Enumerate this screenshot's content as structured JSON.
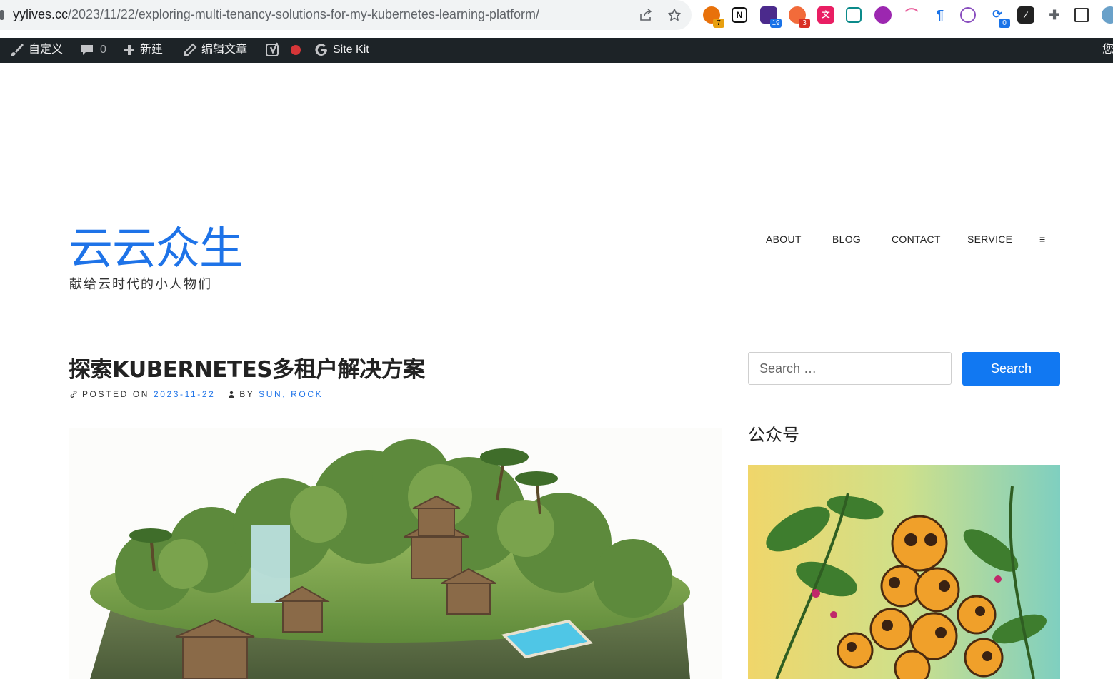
{
  "browser": {
    "url_host": "yylives.cc",
    "url_path": "/2023/11/22/exploring-multi-tenancy-solutions-for-my-kubernetes-learning-platform/",
    "share_icon": "share-icon",
    "bookmark_icon": "star-icon",
    "extensions": [
      {
        "name": "ext-1",
        "badge": "7",
        "color": "#e8710a"
      },
      {
        "name": "notion-ext",
        "badge": "",
        "color": "#111111"
      },
      {
        "name": "ext-graduation",
        "badge": "19",
        "color": "#4b2a8c"
      },
      {
        "name": "ext-orange",
        "badge": "3",
        "color": "#f26b3a"
      },
      {
        "name": "ext-translate",
        "badge": "",
        "color": "#e91e63"
      },
      {
        "name": "ext-teal",
        "badge": "",
        "color": "#0b8a8a"
      },
      {
        "name": "ext-purple",
        "badge": "",
        "color": "#9c27b0"
      },
      {
        "name": "ext-pink",
        "badge": "",
        "color": "#e85d9b"
      },
      {
        "name": "ext-blue",
        "badge": "",
        "color": "#1a73e8"
      },
      {
        "name": "openai-ext",
        "badge": "",
        "color": "#8a4fbf"
      },
      {
        "name": "ext-sync",
        "badge": "0",
        "color": "#1a73e8"
      },
      {
        "name": "ext-dark",
        "badge": "",
        "color": "#222222"
      }
    ],
    "puzzle_icon": "puzzle-icon",
    "sidepanel_icon": "side-panel-icon"
  },
  "adminbar": {
    "customize": "自定义",
    "comments_count": "0",
    "new": "新建",
    "edit_post": "编辑文章",
    "site_kit": "Site Kit",
    "greeting_partial": "您"
  },
  "site": {
    "title": "云云众生",
    "tagline": "献给云时代的小人物们"
  },
  "nav": {
    "items": [
      "ABOUT",
      "BLOG",
      "CONTACT",
      "SERVICE"
    ],
    "menu_icon": "≡"
  },
  "post": {
    "title": "探索KUBERNETES多租户解决方案",
    "posted_on_label": "POSTED ON",
    "date": "2023-11-22",
    "by_label": "BY",
    "author": "SUN, ROCK"
  },
  "sidebar": {
    "search_placeholder": "Search …",
    "search_button": "Search",
    "widget_title": "公众号"
  },
  "colors": {
    "accent": "#1e73e8",
    "button": "#1178f2",
    "adminbar": "#1d2327"
  }
}
